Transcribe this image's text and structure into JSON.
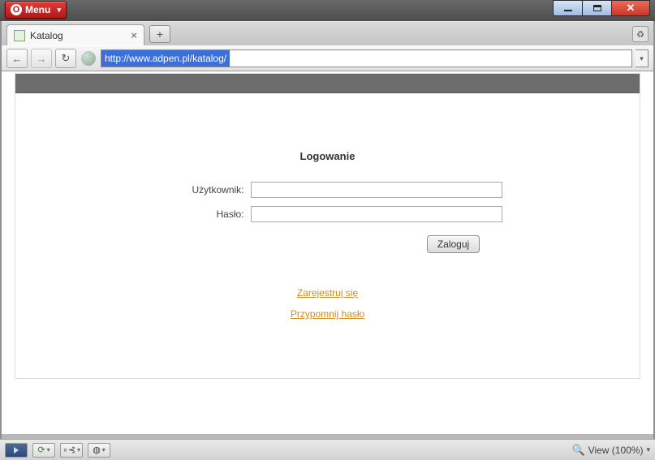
{
  "menu": {
    "label": "Menu"
  },
  "window": {
    "min": "",
    "max": "",
    "close": "✕"
  },
  "tabs": [
    {
      "title": "Katalog"
    }
  ],
  "address": {
    "url": "http://www.adpen.pl/katalog/"
  },
  "page": {
    "login_heading": "Logowanie",
    "user_label": "Użytkownik:",
    "pass_label": "Hasło:",
    "user_value": "",
    "pass_value": "",
    "submit_label": "Zaloguj",
    "register_link": "Zarejestruj się",
    "remind_link": "Przypomnij  hasło"
  },
  "status": {
    "view_label": "View (100%)"
  }
}
